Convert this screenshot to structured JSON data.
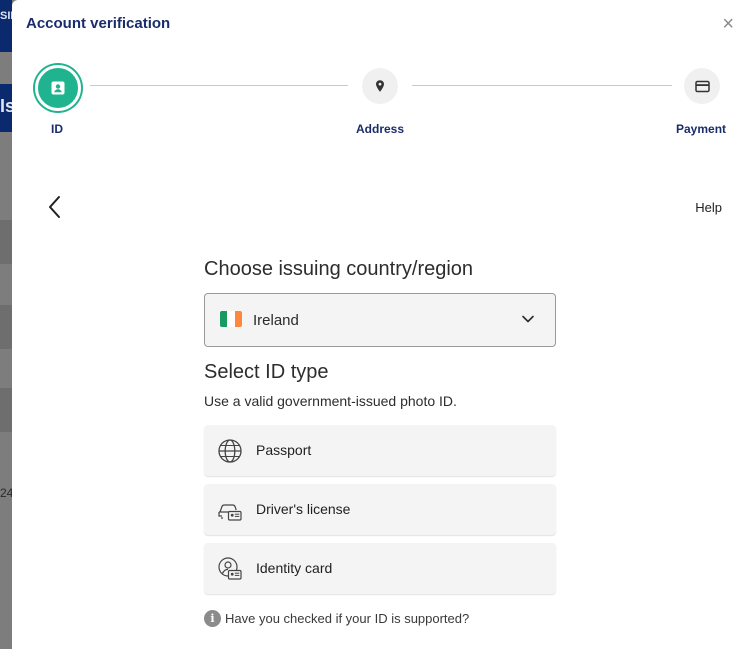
{
  "backdrop": {
    "frag_top": "SIN",
    "frag_mid": "Is",
    "frag_low": "24"
  },
  "modal": {
    "title": "Account verification",
    "close_glyph": "×"
  },
  "steps": [
    {
      "label": "ID",
      "icon": "id-card-icon",
      "active": true
    },
    {
      "label": "Address",
      "icon": "map-pin-icon",
      "active": false
    },
    {
      "label": "Payment",
      "icon": "credit-card-icon",
      "active": false
    }
  ],
  "nav": {
    "help": "Help"
  },
  "country": {
    "heading": "Choose issuing country/region",
    "selected": "Ireland",
    "flag_colors": [
      "#169b62",
      "#ffffff",
      "#ff883e"
    ]
  },
  "id_type": {
    "heading": "Select ID type",
    "subtitle": "Use a valid government-issued photo ID.",
    "options": [
      {
        "label": "Passport",
        "icon": "globe-icon"
      },
      {
        "label": "Driver's license",
        "icon": "car-license-icon"
      },
      {
        "label": "Identity card",
        "icon": "person-card-icon"
      }
    ]
  },
  "support_note": "Have you checked if your ID is supported?",
  "colors": {
    "accent": "#1fb48f",
    "title": "#1a2d6b"
  }
}
